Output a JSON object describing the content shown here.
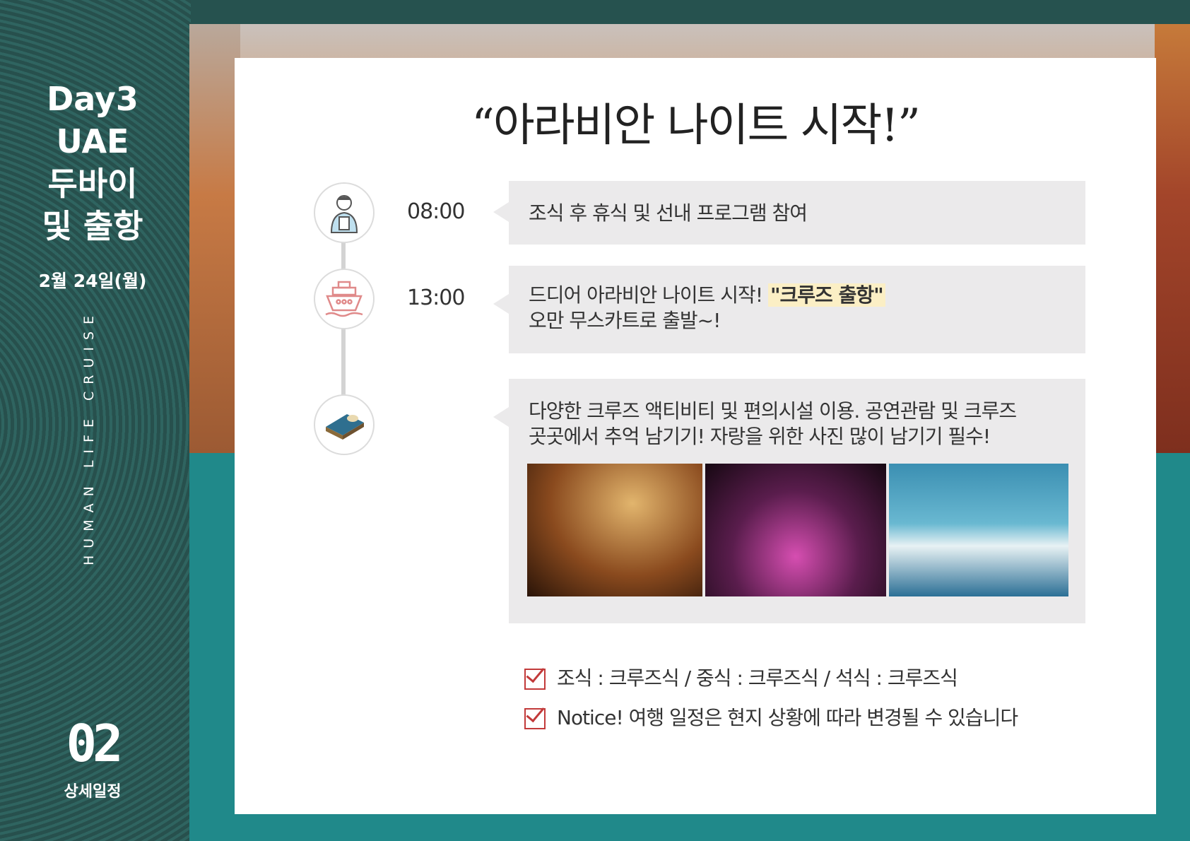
{
  "sidebar": {
    "title_lines": [
      "Day3",
      "UAE",
      "두바이",
      "및 출항"
    ],
    "date": "2월 24일(월)",
    "vertical_text": "HUMAN LIFE CRUISE",
    "page_number": "02",
    "page_label": "상세일정"
  },
  "headline": "“아라비안 나이트 시작!”",
  "timeline": [
    {
      "time": "08:00",
      "icon": "reading-person-icon",
      "lines": [
        "조식 후 휴식 및 선내 프로그램 참여"
      ]
    },
    {
      "time": "13:00",
      "icon": "cruise-ship-icon",
      "line1_prefix": "드디어 아라비안 나이트 시작! ",
      "line1_highlight": "\"크루즈 출항\"",
      "line2": "오만 무스카트로 출발~!"
    },
    {
      "time": "",
      "icon": "bed-icon",
      "lines": [
        "다양한 크루즈 액티비티 및 편의시설 이용. 공연관람 및 크루즈",
        "곳곳에서 추억 남기기! 자랑을 위한 사진 많이 남기기 필수!"
      ],
      "images": [
        "casino-photo",
        "show-photo",
        "surfing-photo"
      ]
    }
  ],
  "notes": {
    "meals": "조식 : 크루즈식   /   중식 : 크루즈식    /   석식 : 크루즈식",
    "notice": "Notice!  여행 일정은 현지 상황에 따라 변경될 수 있습니다"
  }
}
